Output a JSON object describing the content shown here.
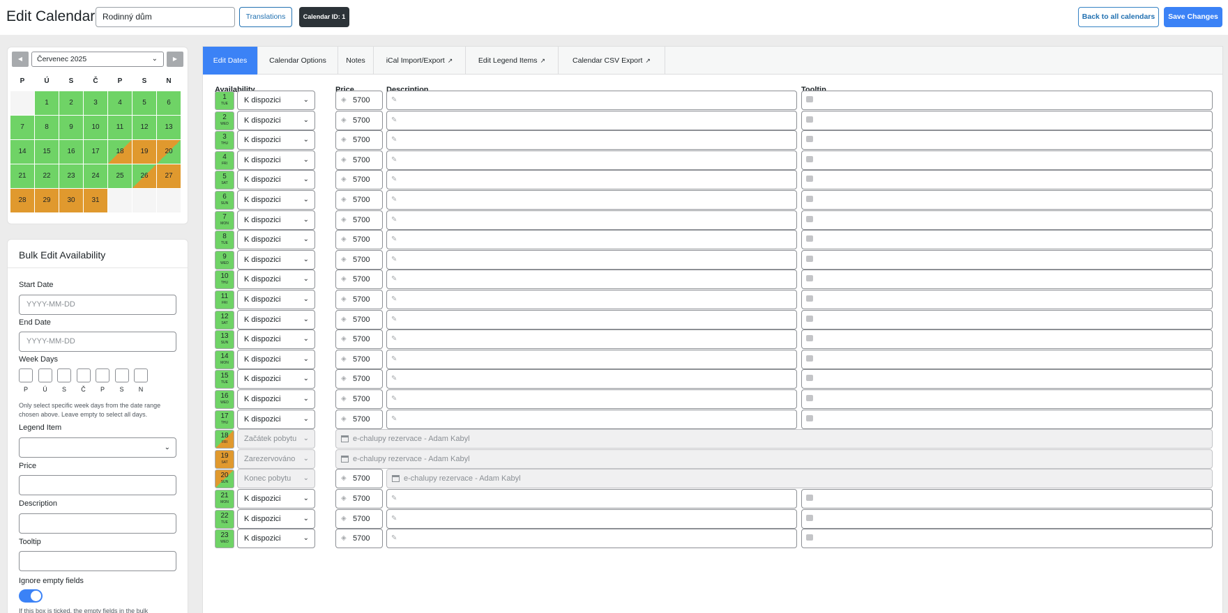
{
  "header": {
    "title": "Edit Calendar",
    "calendar_name": "Rodinný dům",
    "translations_label": "Translations",
    "calendar_id_label": "Calendar ID: 1",
    "back_label": "Back to all calendars",
    "save_label": "Save Changes"
  },
  "mini_calendar": {
    "month_label": "Červenec 2025",
    "prev_icon": "triangle-left-icon",
    "next_icon": "triangle-right-icon",
    "weekdays": [
      "P",
      "Ú",
      "S",
      "Č",
      "P",
      "S",
      "N"
    ],
    "days": [
      {
        "n": "1",
        "s": "free"
      },
      {
        "n": "2",
        "s": "free"
      },
      {
        "n": "3",
        "s": "free"
      },
      {
        "n": "4",
        "s": "free"
      },
      {
        "n": "5",
        "s": "free"
      },
      {
        "n": "6",
        "s": "free"
      },
      {
        "n": "7",
        "s": "free"
      },
      {
        "n": "8",
        "s": "free"
      },
      {
        "n": "9",
        "s": "free"
      },
      {
        "n": "10",
        "s": "free"
      },
      {
        "n": "11",
        "s": "free"
      },
      {
        "n": "12",
        "s": "free"
      },
      {
        "n": "13",
        "s": "free"
      },
      {
        "n": "14",
        "s": "free"
      },
      {
        "n": "15",
        "s": "free"
      },
      {
        "n": "16",
        "s": "free"
      },
      {
        "n": "17",
        "s": "free"
      },
      {
        "n": "18",
        "s": "start"
      },
      {
        "n": "19",
        "s": "booked"
      },
      {
        "n": "20",
        "s": "end"
      },
      {
        "n": "21",
        "s": "free"
      },
      {
        "n": "22",
        "s": "free"
      },
      {
        "n": "23",
        "s": "free"
      },
      {
        "n": "24",
        "s": "free"
      },
      {
        "n": "25",
        "s": "free"
      },
      {
        "n": "26",
        "s": "start"
      },
      {
        "n": "27",
        "s": "booked"
      },
      {
        "n": "28",
        "s": "booked"
      },
      {
        "n": "29",
        "s": "booked"
      },
      {
        "n": "30",
        "s": "booked"
      },
      {
        "n": "31",
        "s": "booked"
      }
    ],
    "colors": {
      "free": "#6fd366",
      "booked": "#e0992e",
      "empty": "#f5f5f5"
    }
  },
  "bulk": {
    "title": "Bulk Edit Availability",
    "start_label": "Start Date",
    "start_placeholder": "YYYY-MM-DD",
    "end_label": "End Date",
    "end_placeholder": "YYYY-MM-DD",
    "weekdays_label": "Week Days",
    "weekdays": [
      "P",
      "Ú",
      "S",
      "Č",
      "P",
      "S",
      "N"
    ],
    "weekdays_help": "Only select specific week days from the date range chosen above. Leave empty to select all days.",
    "legend_label": "Legend Item",
    "legend_value": "",
    "price_label": "Price",
    "price_value": "",
    "description_label": "Description",
    "description_value": "",
    "tooltip_label": "Tooltip",
    "tooltip_value": "",
    "ignore_label": "Ignore empty fields",
    "ignore_on": true,
    "ignore_help": "If this box is ticked, the empty fields in the bulk"
  },
  "tabs": [
    {
      "label": "Edit Dates",
      "active": true,
      "external": false
    },
    {
      "label": "Calendar Options",
      "active": false,
      "external": false
    },
    {
      "label": "Notes",
      "active": false,
      "external": false
    },
    {
      "label": "iCal Import/Export",
      "active": false,
      "external": true
    },
    {
      "label": "Edit Legend Items",
      "active": false,
      "external": true
    },
    {
      "label": "Calendar CSV Export",
      "active": false,
      "external": true
    }
  ],
  "columns": {
    "availability": "Availability",
    "price": "Price",
    "description": "Description",
    "tooltip": "Tooltip"
  },
  "rows": [
    {
      "day": "1",
      "wd": "TUE",
      "status": "K dispozici",
      "price": "5700",
      "kind": "free"
    },
    {
      "day": "2",
      "wd": "WED",
      "status": "K dispozici",
      "price": "5700",
      "kind": "free"
    },
    {
      "day": "3",
      "wd": "THU",
      "status": "K dispozici",
      "price": "5700",
      "kind": "free"
    },
    {
      "day": "4",
      "wd": "FRI",
      "status": "K dispozici",
      "price": "5700",
      "kind": "free"
    },
    {
      "day": "5",
      "wd": "SAT",
      "status": "K dispozici",
      "price": "5700",
      "kind": "free"
    },
    {
      "day": "6",
      "wd": "SUN",
      "status": "K dispozici",
      "price": "5700",
      "kind": "free"
    },
    {
      "day": "7",
      "wd": "MON",
      "status": "K dispozici",
      "price": "5700",
      "kind": "free"
    },
    {
      "day": "8",
      "wd": "TUE",
      "status": "K dispozici",
      "price": "5700",
      "kind": "free"
    },
    {
      "day": "9",
      "wd": "WED",
      "status": "K dispozici",
      "price": "5700",
      "kind": "free"
    },
    {
      "day": "10",
      "wd": "THU",
      "status": "K dispozici",
      "price": "5700",
      "kind": "free"
    },
    {
      "day": "11",
      "wd": "FRI",
      "status": "K dispozici",
      "price": "5700",
      "kind": "free"
    },
    {
      "day": "12",
      "wd": "SAT",
      "status": "K dispozici",
      "price": "5700",
      "kind": "free"
    },
    {
      "day": "13",
      "wd": "SUN",
      "status": "K dispozici",
      "price": "5700",
      "kind": "free"
    },
    {
      "day": "14",
      "wd": "MON",
      "status": "K dispozici",
      "price": "5700",
      "kind": "free"
    },
    {
      "day": "15",
      "wd": "TUE",
      "status": "K dispozici",
      "price": "5700",
      "kind": "free"
    },
    {
      "day": "16",
      "wd": "WED",
      "status": "K dispozici",
      "price": "5700",
      "kind": "free"
    },
    {
      "day": "17",
      "wd": "THU",
      "status": "K dispozici",
      "price": "5700",
      "kind": "free"
    },
    {
      "day": "18",
      "wd": "FRI",
      "status": "Začátek pobytu",
      "price": "",
      "kind": "start",
      "booking": "e-chalupy rezervace - Adam Kabyl"
    },
    {
      "day": "19",
      "wd": "SAT",
      "status": "Zarezervováno",
      "price": "",
      "kind": "booked",
      "booking": "e-chalupy rezervace - Adam Kabyl"
    },
    {
      "day": "20",
      "wd": "SUN",
      "status": "Konec pobytu",
      "price": "5700",
      "kind": "end",
      "booking": "e-chalupy rezervace - Adam Kabyl"
    },
    {
      "day": "21",
      "wd": "MON",
      "status": "K dispozici",
      "price": "5700",
      "kind": "free"
    },
    {
      "day": "22",
      "wd": "TUE",
      "status": "K dispozici",
      "price": "5700",
      "kind": "free"
    },
    {
      "day": "23",
      "wd": "WED",
      "status": "K dispozici",
      "price": "5700",
      "kind": "free"
    }
  ]
}
